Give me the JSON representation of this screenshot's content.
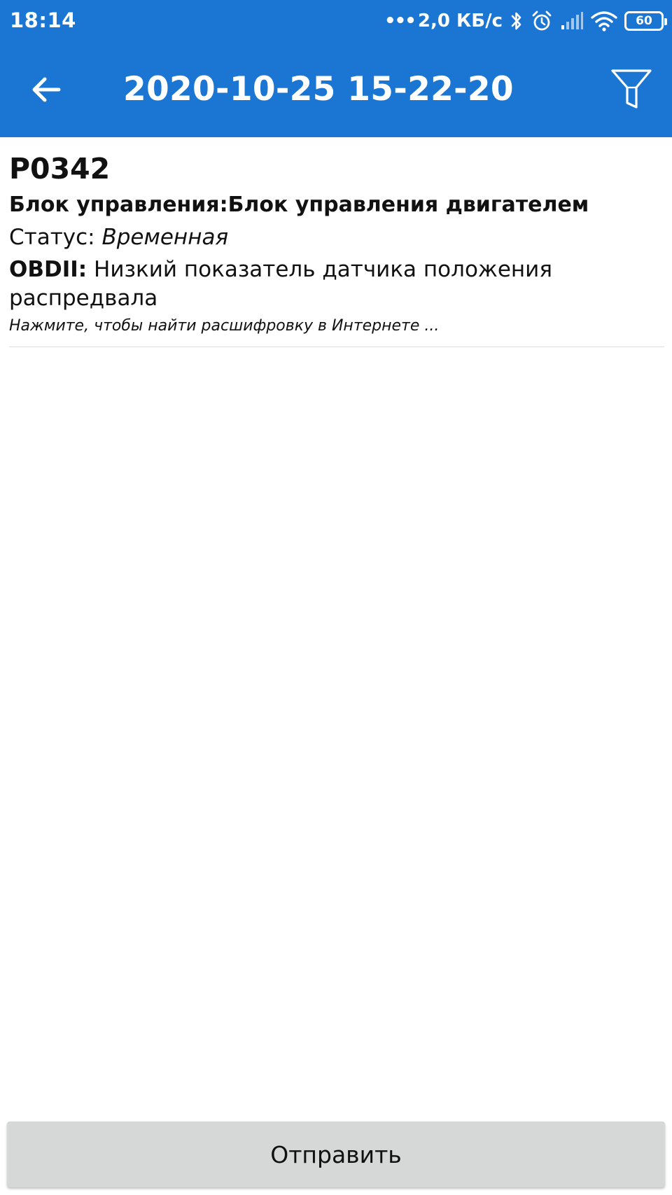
{
  "status_bar": {
    "time": "18:14",
    "dots": "•••",
    "net_speed": "2,0 КБ/с",
    "battery_level": "60",
    "icons": [
      "bluetooth-icon",
      "alarm-icon",
      "signal-icon",
      "wifi-icon",
      "battery-icon"
    ]
  },
  "toolbar": {
    "title": "2020-10-25 15-22-20",
    "back_icon": "arrow-left-icon",
    "filter_icon": "filter-icon"
  },
  "dtc": {
    "code": "P0342",
    "module": "Блок управления:Блок управления двигателем",
    "status_label": "Статус:",
    "status_value": "Временная",
    "desc_prefix": "OBDII:",
    "description": "Низкий показатель датчика положения распредвала",
    "hint": "Нажмите, чтобы найти расшифровку в Интернете ..."
  },
  "actions": {
    "send_label": "Отправить"
  },
  "colors": {
    "appbar": "#1a76d2",
    "button_bg": "#d6d7d7",
    "text": "#111111"
  }
}
